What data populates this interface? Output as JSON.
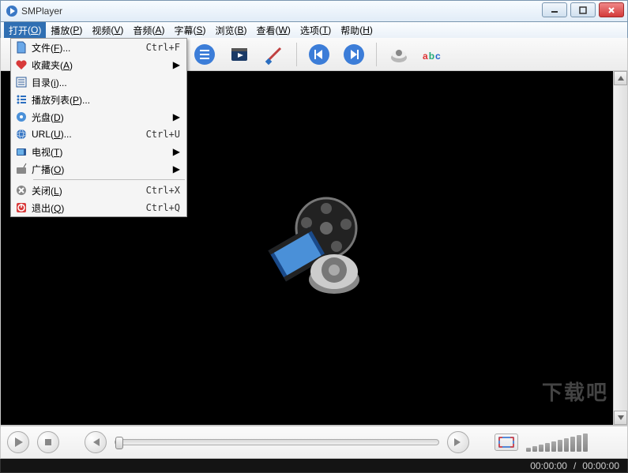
{
  "window": {
    "title": "SMPlayer"
  },
  "menubar": {
    "items": [
      {
        "label": "打开",
        "hotkey": "O",
        "active": true
      },
      {
        "label": "播放",
        "hotkey": "P"
      },
      {
        "label": "视频",
        "hotkey": "V"
      },
      {
        "label": "音频",
        "hotkey": "A"
      },
      {
        "label": "字幕",
        "hotkey": "S"
      },
      {
        "label": "浏览",
        "hotkey": "B"
      },
      {
        "label": "查看",
        "hotkey": "W"
      },
      {
        "label": "选项",
        "hotkey": "T"
      },
      {
        "label": "帮助",
        "hotkey": "H"
      }
    ]
  },
  "open_menu": {
    "items": [
      {
        "icon": "file-icon",
        "label": "文件",
        "hotkey": "F",
        "suffix": "...",
        "shortcut": "Ctrl+F",
        "submenu": false
      },
      {
        "icon": "heart-icon",
        "label": "收藏夹",
        "hotkey": "A",
        "shortcut": "",
        "submenu": true
      },
      {
        "icon": "folder-icon",
        "label": "目录",
        "hotkey": "i",
        "suffix": "...",
        "shortcut": "",
        "submenu": false
      },
      {
        "icon": "list-icon",
        "label": "播放列表",
        "hotkey": "P",
        "suffix": "...",
        "shortcut": "",
        "submenu": false
      },
      {
        "icon": "disc-icon",
        "label": "光盘",
        "hotkey": "D",
        "shortcut": "",
        "submenu": true
      },
      {
        "icon": "globe-icon",
        "label": "URL",
        "hotkey": "U",
        "suffix": "...",
        "shortcut": "Ctrl+U",
        "submenu": false
      },
      {
        "icon": "tv-icon",
        "label": "电视",
        "hotkey": "T",
        "shortcut": "",
        "submenu": true
      },
      {
        "icon": "radio-icon",
        "label": "广播",
        "hotkey": "O",
        "shortcut": "",
        "submenu": true
      },
      {
        "sep": true
      },
      {
        "icon": "close-circle-icon",
        "label": "关闭",
        "hotkey": "L",
        "shortcut": "Ctrl+X",
        "submenu": false
      },
      {
        "icon": "power-icon",
        "label": "退出",
        "hotkey": "Q",
        "shortcut": "Ctrl+Q",
        "submenu": false
      }
    ]
  },
  "toolbar": {
    "icons": [
      "playlist-icon",
      "video-source-icon",
      "screwdriver-icon",
      "skip-prev-icon",
      "skip-next-icon",
      "volume-icon",
      "subtitle-abc-icon"
    ]
  },
  "status": {
    "elapsed": "00:00:00",
    "sep": "/",
    "total": "00:00:00"
  },
  "watermark": "下载吧"
}
